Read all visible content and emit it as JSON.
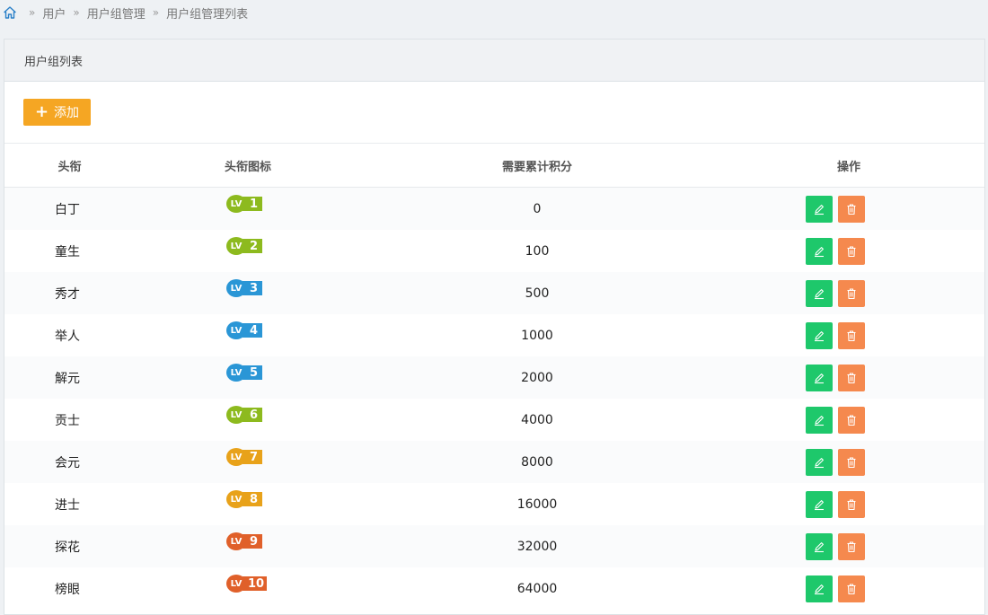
{
  "breadcrumb": {
    "items": [
      "用户",
      "用户组管理",
      "用户组管理列表"
    ]
  },
  "panel": {
    "title": "用户组列表",
    "add_label": "添加"
  },
  "table": {
    "headers": {
      "name": "头衔",
      "icon": "头衔图标",
      "points": "需要累计积分",
      "ops": "操作"
    },
    "rows": [
      {
        "name": "白丁",
        "level": "1",
        "points": "0",
        "color": "#8dba1e"
      },
      {
        "name": "童生",
        "level": "2",
        "points": "100",
        "color": "#8dba1e"
      },
      {
        "name": "秀才",
        "level": "3",
        "points": "500",
        "color": "#2a96d6"
      },
      {
        "name": "举人",
        "level": "4",
        "points": "1000",
        "color": "#2a96d6"
      },
      {
        "name": "解元",
        "level": "5",
        "points": "2000",
        "color": "#2a96d6"
      },
      {
        "name": "贡士",
        "level": "6",
        "points": "4000",
        "color": "#8dba1e"
      },
      {
        "name": "会元",
        "level": "7",
        "points": "8000",
        "color": "#e8a21a"
      },
      {
        "name": "进士",
        "level": "8",
        "points": "16000",
        "color": "#e8a21a"
      },
      {
        "name": "探花",
        "level": "9",
        "points": "32000",
        "color": "#e0602a"
      },
      {
        "name": "榜眼",
        "level": "10",
        "points": "64000",
        "color": "#e0602a"
      }
    ]
  },
  "colors": {
    "add_button": "#f5a623",
    "edit_button": "#1ec86b",
    "delete_button": "#f5894e"
  }
}
